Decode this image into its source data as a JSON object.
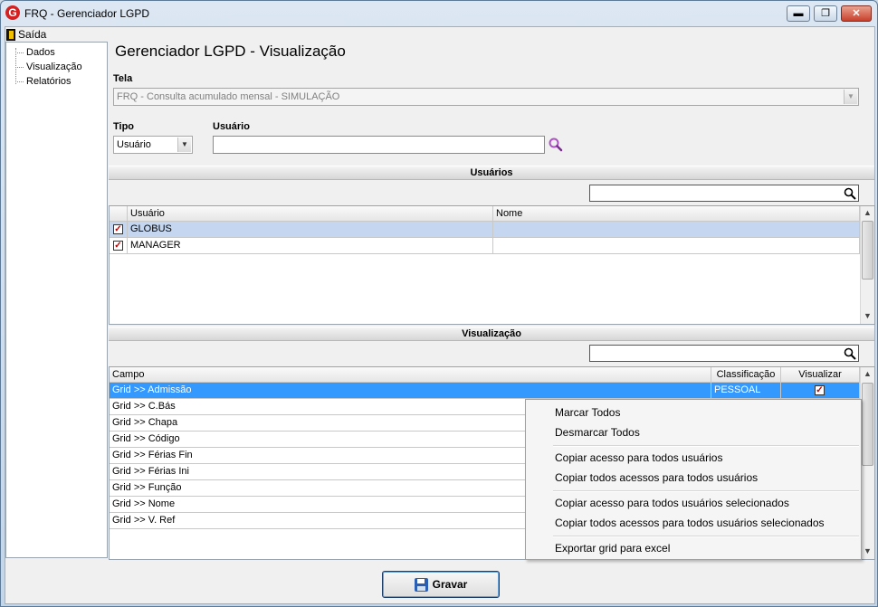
{
  "window": {
    "title": "FRQ - Gerenciador LGPD",
    "min": "▬",
    "max": "❐",
    "close": "✕"
  },
  "menu": {
    "exit": "Saída"
  },
  "tree": {
    "items": [
      "Dados",
      "Visualização",
      "Relatórios"
    ]
  },
  "page": {
    "title": "Gerenciador LGPD - Visualização"
  },
  "tela": {
    "label": "Tela",
    "value": "FRQ - Consulta acumulado mensal - SIMULAÇÃO"
  },
  "tipo": {
    "label": "Tipo",
    "value": "Usuário"
  },
  "usuario": {
    "label": "Usuário",
    "value": ""
  },
  "usuarios": {
    "header": "Usuários",
    "filter": "",
    "columns": [
      "Usuário",
      "Nome"
    ],
    "rows": [
      {
        "user": "GLOBUS",
        "name": "",
        "checked": true,
        "selected": true
      },
      {
        "user": "MANAGER",
        "name": "",
        "checked": true,
        "selected": false
      }
    ]
  },
  "visualizacao": {
    "header": "Visualização",
    "filter": "",
    "columns": [
      "Campo",
      "Classificação",
      "Visualizar"
    ],
    "rows": [
      {
        "campo": "Grid >> Admissão",
        "classificacao": "PESSOAL",
        "visualizar": true,
        "selected": true
      },
      {
        "campo": "Grid >> C.Bás",
        "classificacao": "",
        "visualizar": false,
        "selected": false
      },
      {
        "campo": "Grid >> Chapa",
        "classificacao": "",
        "visualizar": false,
        "selected": false
      },
      {
        "campo": "Grid >> Código",
        "classificacao": "",
        "visualizar": false,
        "selected": false
      },
      {
        "campo": "Grid >> Férias Fin",
        "classificacao": "",
        "visualizar": false,
        "selected": false
      },
      {
        "campo": "Grid >> Férias Ini",
        "classificacao": "",
        "visualizar": false,
        "selected": false
      },
      {
        "campo": "Grid >> Função",
        "classificacao": "",
        "visualizar": false,
        "selected": false
      },
      {
        "campo": "Grid >> Nome",
        "classificacao": "",
        "visualizar": false,
        "selected": false
      },
      {
        "campo": "Grid >> V. Ref",
        "classificacao": "",
        "visualizar": false,
        "selected": false
      }
    ]
  },
  "context_menu": {
    "items": [
      "Marcar Todos",
      "Desmarcar Todos",
      "Copiar acesso para todos usuários",
      "Copiar todos acessos para todos usuários",
      "Copiar acesso para todos usuários selecionados",
      "Copiar todos acessos para todos usuários selecionados",
      "Exportar grid para excel"
    ]
  },
  "buttons": {
    "save": "Gravar"
  },
  "colors": {
    "selection": "#3399ff",
    "selection_light": "#c5d7f0",
    "check": "#c00000",
    "search_icon_accent": "#b050c8"
  }
}
